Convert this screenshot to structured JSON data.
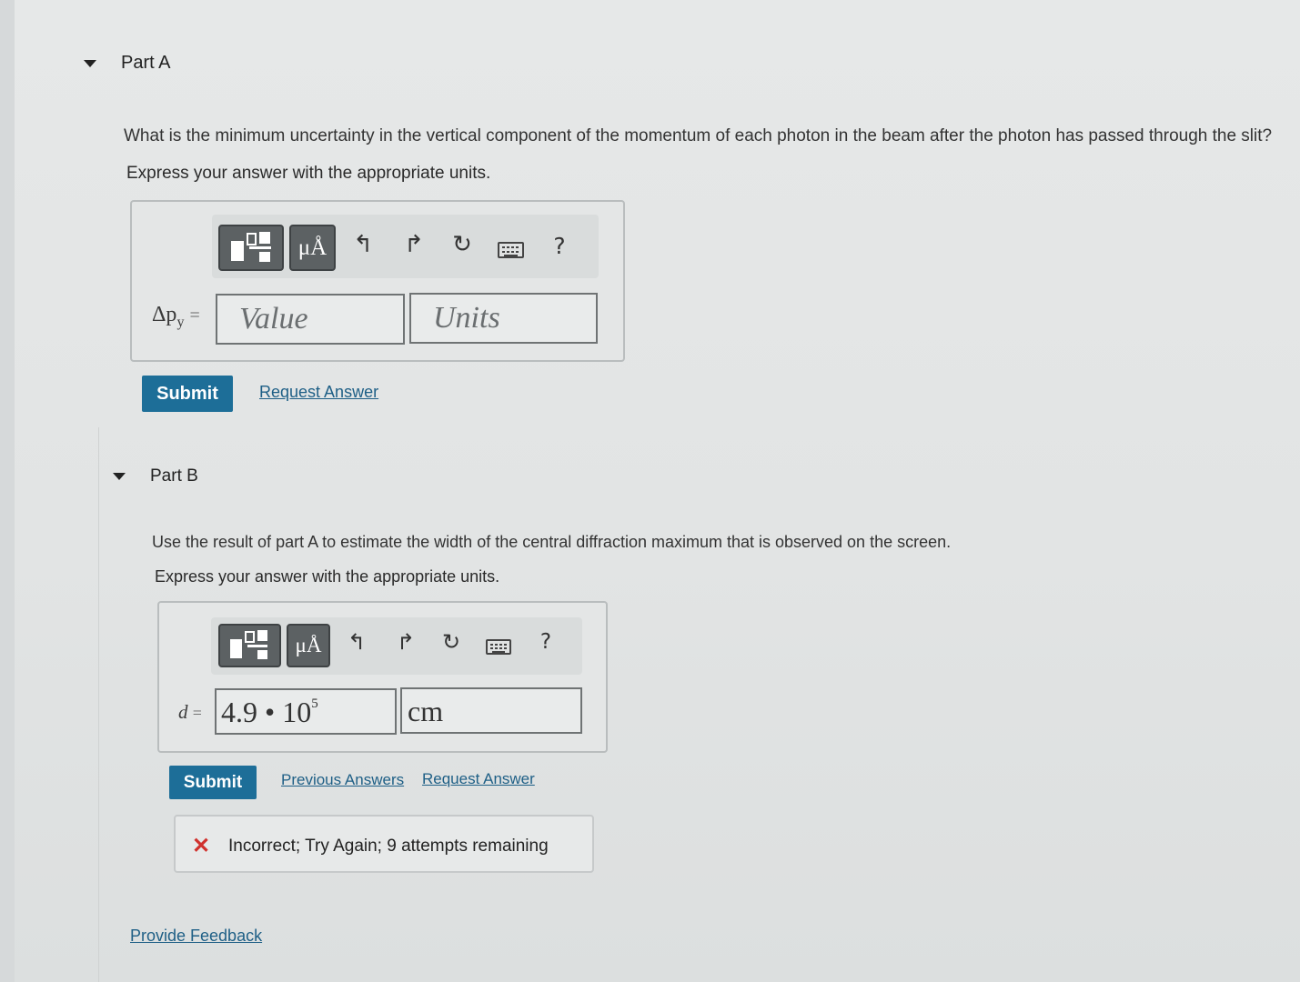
{
  "part_a": {
    "title": "Part A",
    "question": "What is the minimum uncertainty in the vertical component of the momentum of each photon in the beam after the photon has passed through the slit?",
    "instruction": "Express your answer with the appropriate units.",
    "variable_label": "Δp",
    "variable_subscript": "y",
    "equals": "=",
    "value_placeholder": "Value",
    "units_placeholder": "Units",
    "submit_label": "Submit",
    "request_answer_label": "Request Answer"
  },
  "part_b": {
    "title": "Part B",
    "question": "Use the result of part A to estimate the width of the central diffraction maximum that is observed on the screen.",
    "instruction": "Express your answer with the appropriate units.",
    "variable_label": "d",
    "equals": "=",
    "value_mantissa": "4.9 • 10",
    "value_exponent": "5",
    "units_value": "cm",
    "submit_label": "Submit",
    "previous_answers_label": "Previous Answers",
    "request_answer_label": "Request Answer",
    "feedback_text": "Incorrect; Try Again; 9 attempts remaining"
  },
  "toolbar": {
    "units_button_label": "μÅ",
    "help_label": "?"
  },
  "footer": {
    "provide_feedback_label": "Provide Feedback"
  },
  "colors": {
    "submit_bg": "#1d6e98",
    "link": "#1e5f86",
    "error": "#d0312d"
  },
  "icons": [
    "templates-icon",
    "units-icon",
    "undo-icon",
    "redo-icon",
    "reset-icon",
    "keyboard-icon",
    "help-icon",
    "error-x-icon",
    "collapse-triangle-icon"
  ]
}
